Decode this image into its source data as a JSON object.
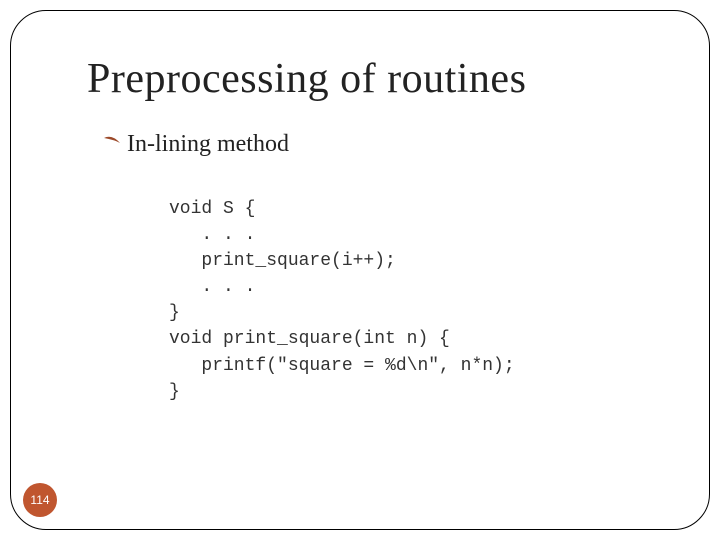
{
  "title": "Preprocessing of routines",
  "bullet": {
    "icon": "༼",
    "text": "In-lining method"
  },
  "code": "void S {\n   . . .\n   print_square(i++);\n   . . .\n}\nvoid print_square(int n) {\n   printf(\"square = %d\\n\", n*n);\n}",
  "page_number": "114"
}
